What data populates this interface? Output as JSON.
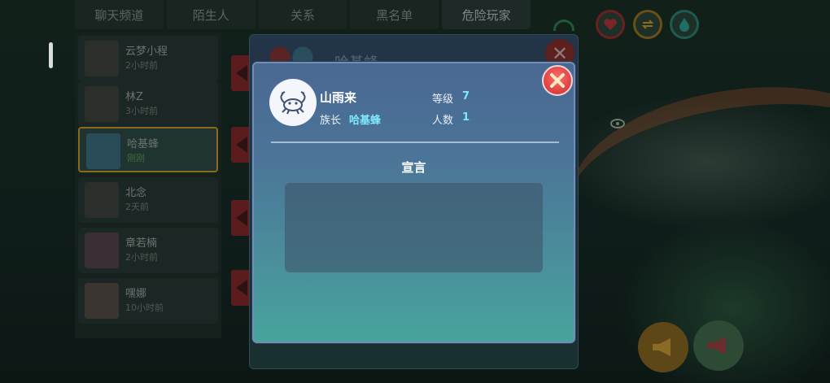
{
  "tabs": [
    {
      "label": "聊天频道",
      "active": false
    },
    {
      "label": "陌生人",
      "active": false
    },
    {
      "label": "关系",
      "active": false
    },
    {
      "label": "黑名单",
      "active": false
    },
    {
      "label": "危险玩家",
      "active": true
    }
  ],
  "list": {
    "items": [
      {
        "name": "云梦小程",
        "time": "2小时前"
      },
      {
        "name": "林Z",
        "time": "3小时前"
      },
      {
        "name": "哈基蜂",
        "time": "刚刚",
        "selected": true
      },
      {
        "name": "北念",
        "time": "2天前"
      },
      {
        "name": "章若楠",
        "time": "2小时前"
      },
      {
        "name": "嘿娜",
        "time": "10小时前"
      }
    ]
  },
  "back_dialog": {
    "title": "哈基蜂"
  },
  "dialog": {
    "player_name": "山雨来",
    "leader_label": "族长",
    "leader_value": "哈基蜂",
    "level_label": "等级",
    "level_value": "7",
    "members_label": "人数",
    "members_value": "1",
    "section_title": "宣言",
    "declaration_text": ""
  },
  "icons": {
    "close": "close-x-icon",
    "avatar": "crab-icon"
  },
  "colors": {
    "close_red": "#d94141",
    "value_cyan": "#7fe8ff",
    "dialog_top": "#4a6892",
    "dialog_bottom": "#47a49d"
  }
}
